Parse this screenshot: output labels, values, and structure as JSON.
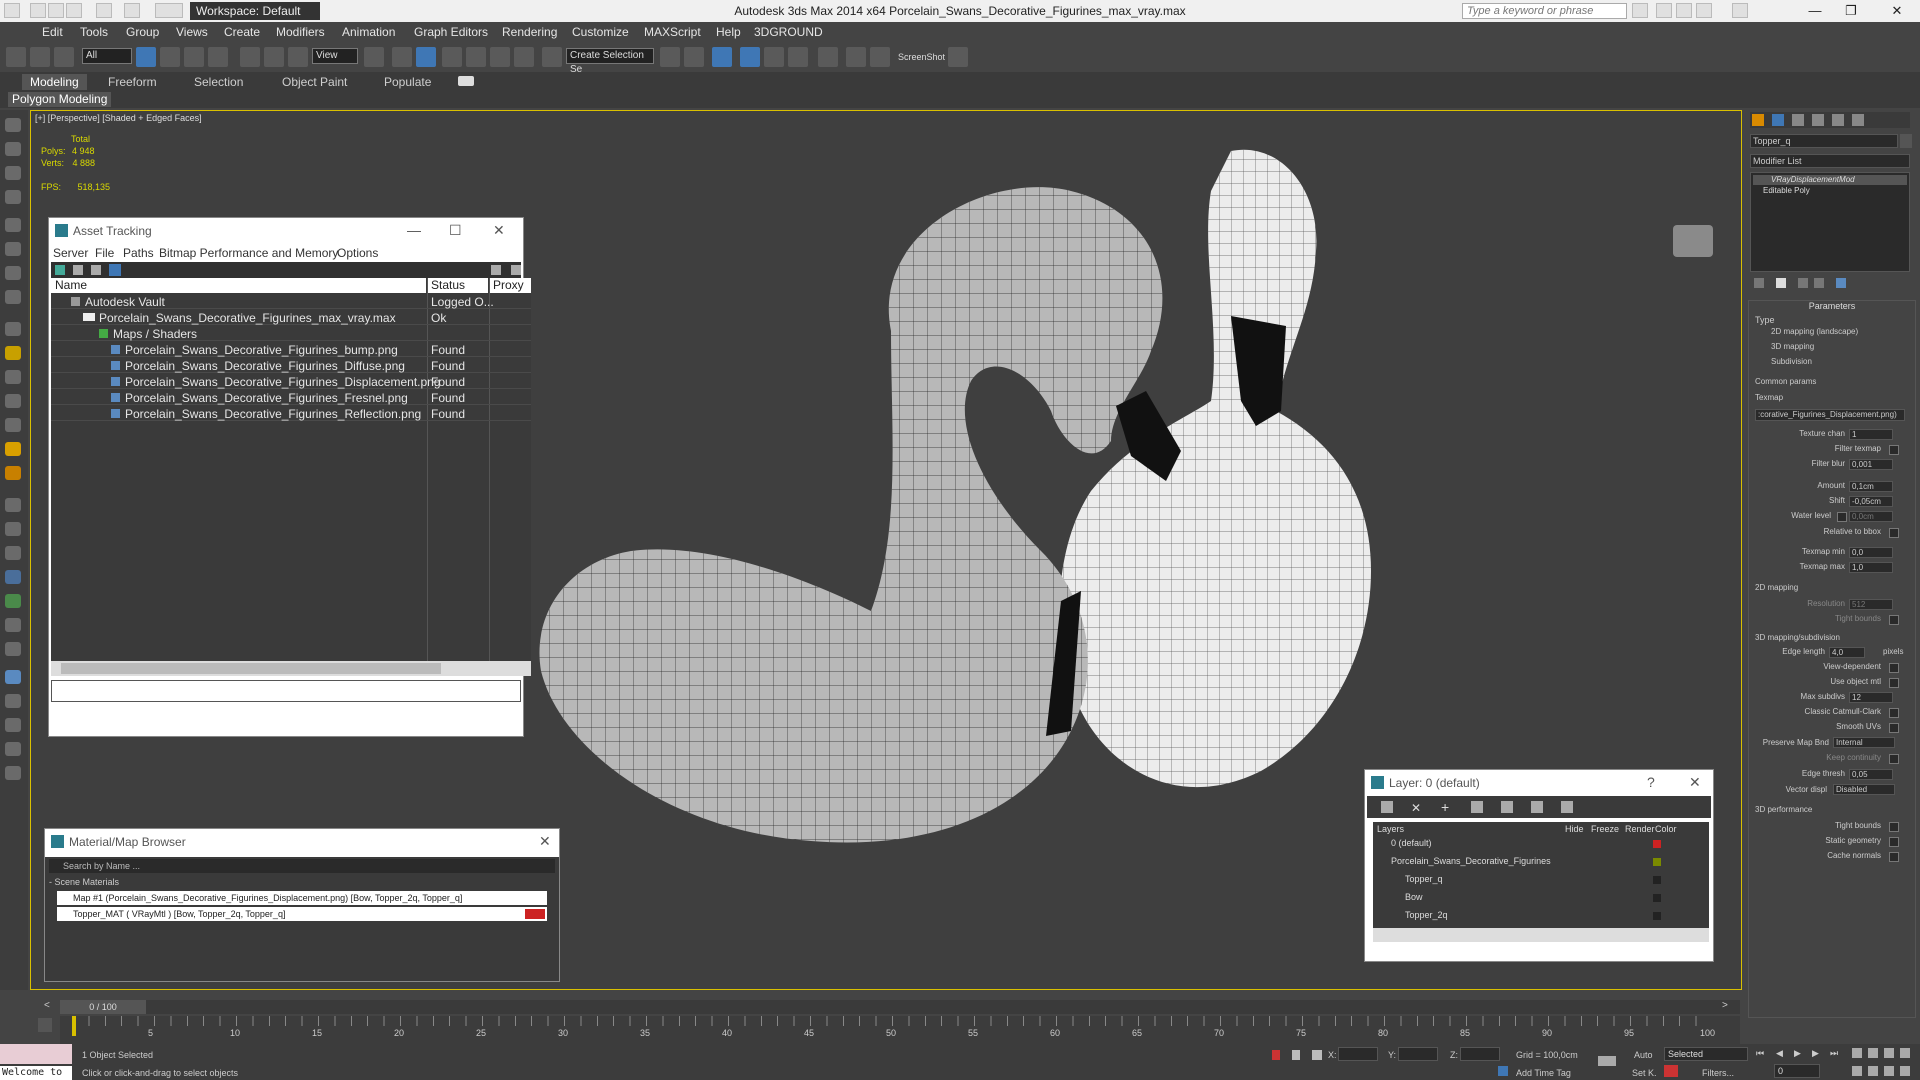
{
  "app": {
    "title": "Autodesk 3ds Max  2014 x64     Porcelain_Swans_Decorative_Figurines_max_vray.max",
    "workspace": "Workspace: Default",
    "search_placeholder": "Type a keyword or phrase"
  },
  "menus": [
    "Edit",
    "Tools",
    "Group",
    "Views",
    "Create",
    "Modifiers",
    "Animation",
    "Graph Editors",
    "Rendering",
    "Customize",
    "MAXScript",
    "Help",
    "3DGROUND"
  ],
  "toolbar": {
    "filter": "All",
    "refcoord": "View",
    "selection_set": "Create Selection Se",
    "screenshot": "ScreenShot"
  },
  "ribbon": {
    "tabs": [
      "Modeling",
      "Freeform",
      "Selection",
      "Object Paint",
      "Populate"
    ],
    "active_panel": "Polygon Modeling"
  },
  "viewport": {
    "label": "[+] [Perspective] [Shaded + Edged Faces]",
    "stats": {
      "total_label": "Total",
      "polys_label": "Polys:",
      "polys_value": "4 948",
      "verts_label": "Verts:",
      "verts_value": "4 888",
      "fps_label": "FPS:",
      "fps_value": "518,135"
    }
  },
  "asset_tracking": {
    "title": "Asset Tracking",
    "menus": [
      "Server",
      "File",
      "Paths",
      "Bitmap Performance and Memory",
      "Options"
    ],
    "columns": [
      "Name",
      "Status",
      "Proxy"
    ],
    "rows": [
      {
        "name": "Autodesk Vault",
        "status": "Logged O..."
      },
      {
        "name": "Porcelain_Swans_Decorative_Figurines_max_vray.max",
        "status": "Ok"
      },
      {
        "name": "Maps / Shaders",
        "status": ""
      },
      {
        "name": "Porcelain_Swans_Decorative_Figurines_bump.png",
        "status": "Found"
      },
      {
        "name": "Porcelain_Swans_Decorative_Figurines_Diffuse.png",
        "status": "Found"
      },
      {
        "name": "Porcelain_Swans_Decorative_Figurines_Displacement.png",
        "status": "Found"
      },
      {
        "name": "Porcelain_Swans_Decorative_Figurines_Fresnel.png",
        "status": "Found"
      },
      {
        "name": "Porcelain_Swans_Decorative_Figurines_Reflection.png",
        "status": "Found"
      }
    ]
  },
  "material_browser": {
    "title": "Material/Map Browser",
    "search_placeholder": "Search by Name ...",
    "section": "- Scene Materials",
    "items": [
      "Map #1 (Porcelain_Swans_Decorative_Figurines_Displacement.png) [Bow, Topper_2q, Topper_q]",
      "Topper_MAT ( VRayMtl ) [Bow, Topper_2q, Topper_q]"
    ]
  },
  "layer_window": {
    "title": "Layer: 0 (default)",
    "columns": [
      "Layers",
      "Hide",
      "Freeze",
      "Render",
      "Color"
    ],
    "rows": [
      {
        "name": "0 (default)",
        "color": "#cc2222"
      },
      {
        "name": "Porcelain_Swans_Decorative_Figurines",
        "color": "#7a8a00"
      },
      {
        "name": "Topper_q",
        "color": "#222222"
      },
      {
        "name": "Bow",
        "color": "#222222"
      },
      {
        "name": "Topper_2q",
        "color": "#222222"
      }
    ]
  },
  "command_panel": {
    "object_name": "Topper_q",
    "modifier_list": "Modifier List",
    "stack": [
      "VRayDisplacementMod",
      "Editable Poly"
    ],
    "rollout_title": "Parameters",
    "type_label": "Type",
    "type_options": [
      "2D mapping (landscape)",
      "3D mapping",
      "Subdivision"
    ],
    "common_params": "Common params",
    "texmap_label": "Texmap",
    "texmap_value": ":corative_Figurines_Displacement.png)",
    "fields": [
      {
        "label": "Texture chan",
        "value": "1"
      },
      {
        "label": "Filter texmap",
        "value": ""
      },
      {
        "label": "Filter blur",
        "value": "0,001"
      },
      {
        "label": "Amount",
        "value": "0,1cm"
      },
      {
        "label": "Shift",
        "value": "-0,05cm"
      },
      {
        "label": "Water level",
        "value": "0,0cm"
      },
      {
        "label": "Relative to bbox",
        "value": ""
      },
      {
        "label": "Texmap min",
        "value": "0,0"
      },
      {
        "label": "Texmap max",
        "value": "1,0"
      }
    ],
    "mapping2d": "2D mapping",
    "resolution_label": "Resolution",
    "resolution_value": "512",
    "tight_bounds_label": "Tight bounds",
    "mapping3d": "3D mapping/subdivision",
    "edge_length_label": "Edge length",
    "edge_length_value": "4,0",
    "pixels_label": "pixels",
    "checks3d": [
      "View-dependent",
      "Use object mtl"
    ],
    "max_subdivs_label": "Max subdivs",
    "max_subdivs_value": "12",
    "checks3d_b": [
      "Classic Catmull-Clark",
      "Smooth UVs"
    ],
    "preserve_label": "Preserve Map Bnd",
    "preserve_value": "Internal",
    "keep_continuity": "Keep continuity",
    "edge_thresh_label": "Edge thresh",
    "edge_thresh_value": "0,05",
    "vector_displ_label": "Vector displ",
    "vector_displ_value": "Disabled",
    "perf_title": "3D performance",
    "perf_checks": [
      "Tight bounds",
      "Static geometry",
      "Cache normals"
    ]
  },
  "timeline": {
    "frame_display": "0 / 100",
    "ticks": [
      "5",
      "10",
      "15",
      "20",
      "25",
      "30",
      "35",
      "40",
      "45",
      "50",
      "55",
      "60",
      "65",
      "70",
      "75",
      "80",
      "85",
      "90",
      "95",
      "100"
    ]
  },
  "status": {
    "welcome": "Welcome to",
    "selection": "1 Object Selected",
    "prompt": "Click or click-and-drag to select objects",
    "x_label": "X:",
    "y_label": "Y:",
    "z_label": "Z:",
    "grid": "Grid = 100,0cm",
    "add_time_tag": "Add Time Tag",
    "auto": "Auto",
    "set_k": "Set K.",
    "selected": "Selected",
    "filters": "Filters...",
    "frame": "0"
  }
}
